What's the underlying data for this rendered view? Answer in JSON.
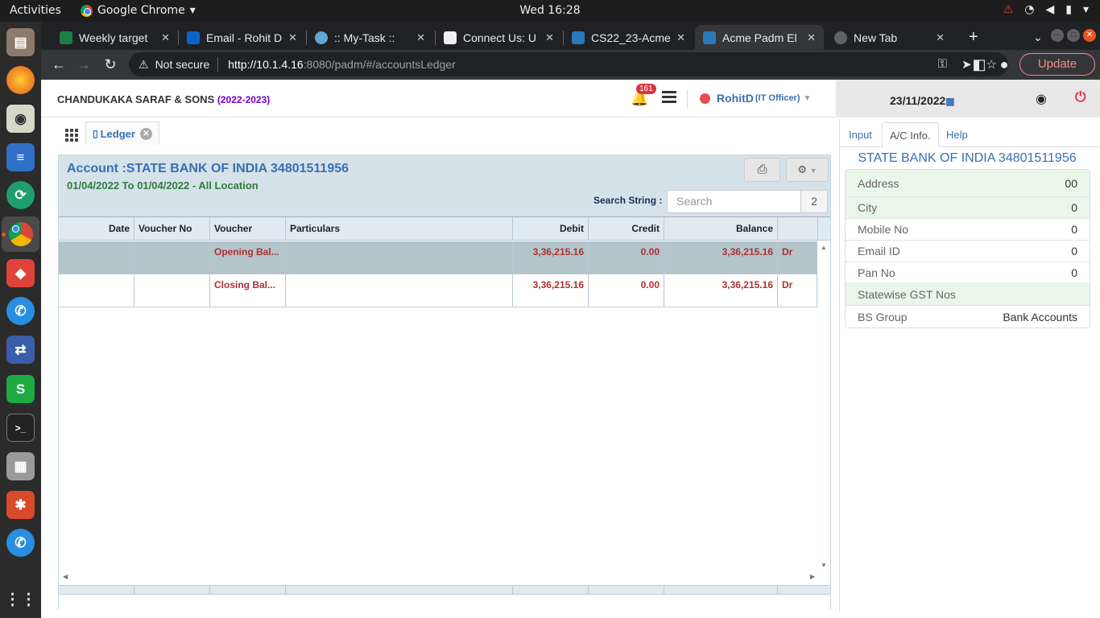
{
  "os": {
    "activities": "Activities",
    "app_menu": "Google Chrome",
    "clock": "Wed 16:28"
  },
  "browser": {
    "tabs": [
      {
        "title": "Weekly target",
        "color": "#1e7e45"
      },
      {
        "title": "Email - Rohit D",
        "color": "#0a64c8"
      },
      {
        "title": ":: My-Task ::",
        "color": "#5fa8d3"
      },
      {
        "title": "Connect Us: U",
        "color": "#f0f0f0"
      },
      {
        "title": "CS22_23-Acme",
        "color": "#2a7ab8"
      },
      {
        "title": "Acme Padm El",
        "color": "#2a7ab8"
      },
      {
        "title": "New Tab",
        "color": "#5f6368"
      }
    ],
    "not_secure": "Not secure",
    "url_host": "http://10.1.4.16",
    "url_path": ":8080/padm/#/accountsLedger",
    "update_label": "Update"
  },
  "header": {
    "company": "CHANDUKAKA SARAF & SONS",
    "year": "(2022-2023)",
    "notification_count": "161",
    "user_name": "RohitD",
    "user_role": "(IT Officer)",
    "date": "23/11/2022"
  },
  "ledger": {
    "tab_label": "Ledger",
    "account_title": "Account :STATE BANK OF INDIA 34801511956",
    "subtitle": "01/04/2022 To 01/04/2022 - All Location",
    "search_label": "Search String :",
    "search_placeholder": "Search",
    "search_count": "2",
    "columns": [
      "Date",
      "Voucher No",
      "Voucher",
      "Particulars",
      "Debit",
      "Credit",
      "Balance",
      ""
    ],
    "rows": [
      {
        "date": "",
        "voucher_no": "",
        "voucher": "Opening Bal...",
        "particulars": "",
        "debit": "3,36,215.16",
        "credit": "0.00",
        "balance": "3,36,215.16",
        "drcr": "Dr"
      },
      {
        "date": "",
        "voucher_no": "",
        "voucher": "Closing Bal...",
        "particulars": "",
        "debit": "3,36,215.16",
        "credit": "0.00",
        "balance": "3,36,215.16",
        "drcr": "Dr"
      }
    ]
  },
  "info": {
    "tabs": [
      "Input",
      "A/C Info.",
      "Help"
    ],
    "title": "STATE BANK OF INDIA 34801511956",
    "rows": [
      {
        "key": "Address",
        "value": "00"
      },
      {
        "key": "City",
        "value": "0"
      },
      {
        "key": "Mobile No",
        "value": "0"
      },
      {
        "key": "Email ID",
        "value": "0"
      },
      {
        "key": "Pan No",
        "value": "0"
      },
      {
        "key": "Statewise GST Nos",
        "value": ""
      },
      {
        "key": "BS Group",
        "value": "Bank Accounts"
      }
    ]
  }
}
